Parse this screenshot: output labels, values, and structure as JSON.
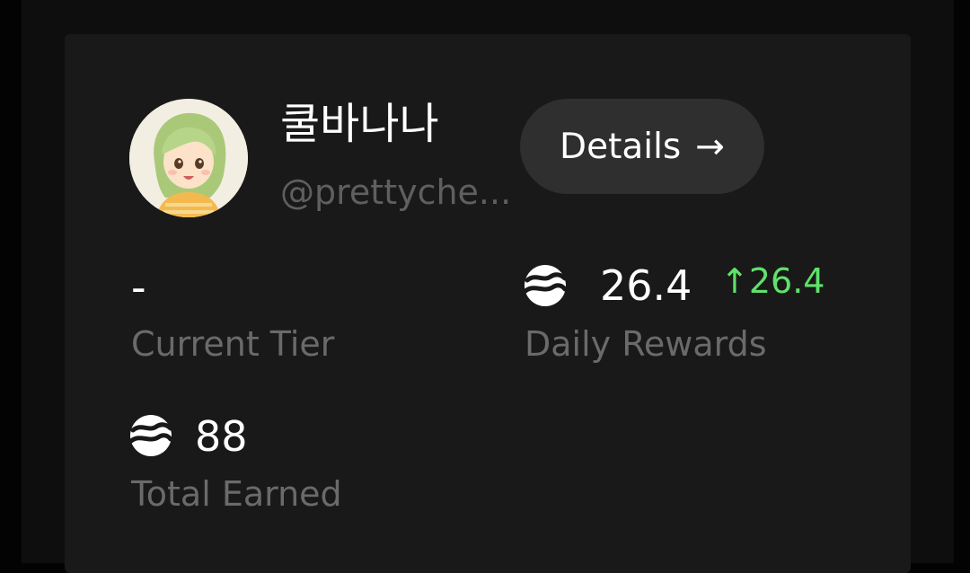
{
  "profile": {
    "display_name": "쿨바나나",
    "handle": "@prettyche..."
  },
  "details_button": {
    "label": "Details",
    "arrow": "→",
    "icon": "arrow-right-icon"
  },
  "stats": {
    "current_tier": {
      "value": "-",
      "label": "Current Tier"
    },
    "daily_rewards": {
      "value": "26.4",
      "delta": "26.4",
      "delta_arrow": "↑",
      "label": "Daily Rewards",
      "icon": "token-coin-icon"
    },
    "total_earned": {
      "value": "88",
      "label": "Total Earned",
      "icon": "token-coin-icon"
    }
  },
  "colors": {
    "background": "#030303",
    "card": "#191919",
    "button": "#2f2f2f",
    "muted_text": "#6a6a6a",
    "positive": "#5fe26a"
  }
}
